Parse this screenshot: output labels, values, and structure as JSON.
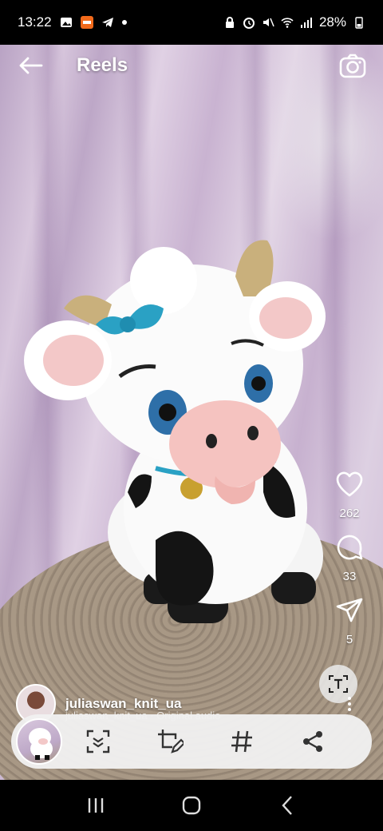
{
  "status_bar": {
    "time": "13:22",
    "battery": "28%"
  },
  "header": {
    "title": "Reels"
  },
  "actions": {
    "likes": "262",
    "comments": "33",
    "shares": "5"
  },
  "post": {
    "username": "juliaswan_knit_ua",
    "audio": "juliaswan_knit_ua · Original audio"
  },
  "icons": {
    "back": "arrow-left-icon",
    "camera": "camera-icon",
    "like": "heart-icon",
    "comment": "comment-icon",
    "share": "send-icon",
    "text_extract": "text-scan-icon",
    "more": "more-vertical-icon",
    "scan": "scan-icon",
    "draw": "crop-edit-icon",
    "tag": "hashtag-icon",
    "share_sheet": "share-icon"
  },
  "colors": {
    "curtain": "#d8c7dd",
    "basket": "#a89885",
    "toolbar": "#f0f0f0"
  }
}
